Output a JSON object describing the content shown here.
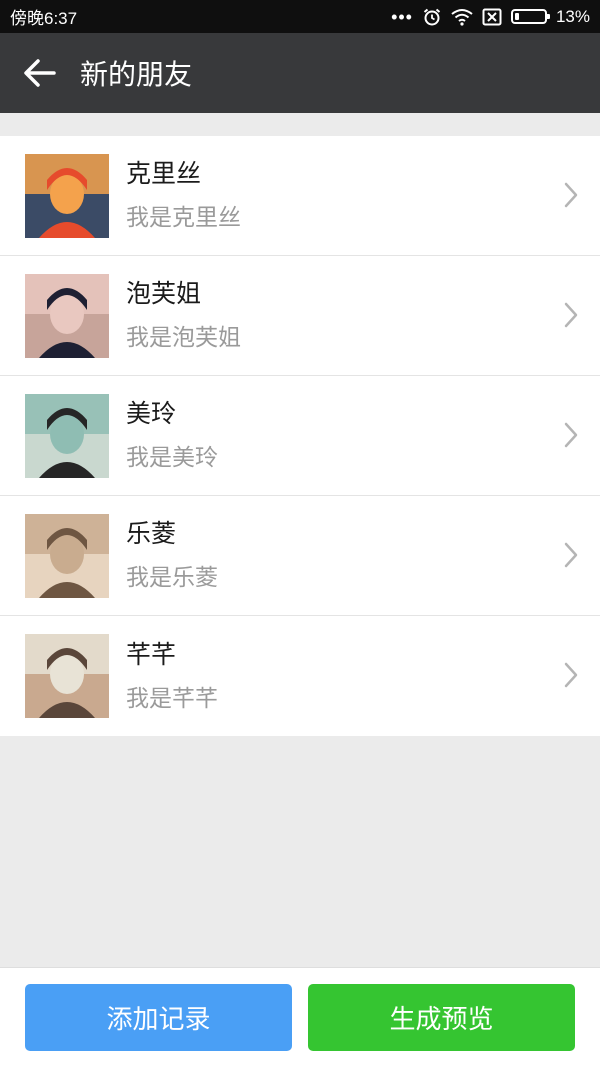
{
  "status_bar": {
    "time": "傍晚6:37",
    "dots": "•••",
    "battery_text": "13%",
    "battery_level": 0.13,
    "icons": [
      "alarm-icon",
      "wifi-icon",
      "no-sim-icon",
      "battery-icon"
    ]
  },
  "header": {
    "title": "新的朋友",
    "back_icon": "arrow-left-icon"
  },
  "friends": [
    {
      "name": "克里丝",
      "message": "我是克里丝",
      "avatar_colors": [
        "#f4a24c",
        "#e64b2c",
        "#3b4b66"
      ]
    },
    {
      "name": "泡芙姐",
      "message": "我是泡芙姐",
      "avatar_colors": [
        "#e9c8c0",
        "#1e2033",
        "#c7a49a"
      ]
    },
    {
      "name": "美玲",
      "message": "我是美玲",
      "avatar_colors": [
        "#8fbdb3",
        "#262626",
        "#c9d8cf"
      ]
    },
    {
      "name": "乐菱",
      "message": "我是乐菱",
      "avatar_colors": [
        "#c9ac8f",
        "#6e5642",
        "#e7d4bf"
      ]
    },
    {
      "name": "芊芊",
      "message": "我是芊芊",
      "avatar_colors": [
        "#e8e3d6",
        "#5a463a",
        "#c9a98f"
      ]
    }
  ],
  "actions": {
    "add_label": "添加记录",
    "preview_label": "生成预览",
    "add_color": "#4a9ff5",
    "preview_color": "#35c531"
  },
  "colors": {
    "title_bar": "#38393b",
    "status_bar": "#0f0f0f",
    "page_bg": "#ebebeb"
  }
}
